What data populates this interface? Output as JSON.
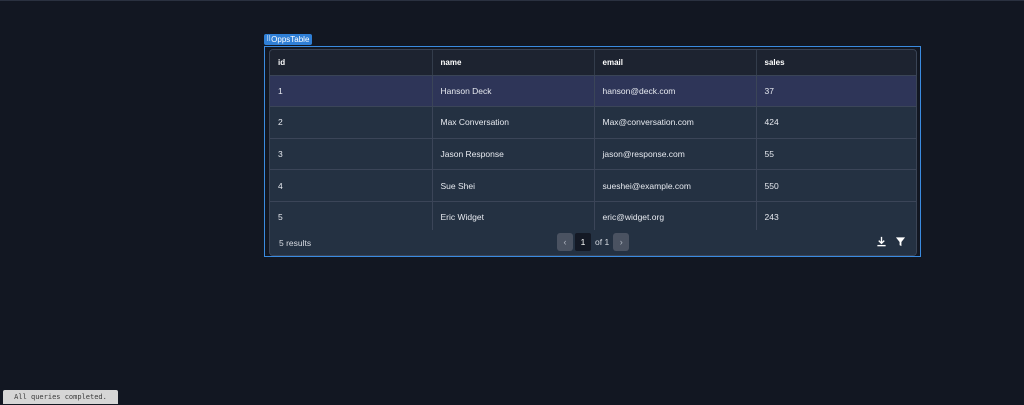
{
  "widget": {
    "tag_label": "OppsTable"
  },
  "table": {
    "columns": [
      "id",
      "name",
      "email",
      "sales"
    ],
    "rows": [
      [
        "1",
        "Hanson Deck",
        "hanson@deck.com",
        "37"
      ],
      [
        "2",
        "Max Conversation",
        "Max@conversation.com",
        "424"
      ],
      [
        "3",
        "Jason Response",
        "jason@response.com",
        "55"
      ],
      [
        "4",
        "Sue Shei",
        "sueshei@example.com",
        "550"
      ],
      [
        "5",
        "Eric Widget",
        "eric@widget.org",
        "243"
      ]
    ],
    "selected_row_id": "1"
  },
  "footer": {
    "results_text": "5 results",
    "prev_icon": "chevron-left-icon",
    "next_icon": "chevron-right-icon",
    "current_page": "1",
    "of_text": "of 1",
    "download_icon": "download-icon",
    "filter_icon": "filter-icon"
  },
  "status": {
    "text": "All queries completed."
  },
  "colors": {
    "background": "#121722",
    "accent": "#2f7fd6",
    "selected_row": "#2e3558",
    "row": "#243142",
    "header": "#1d2330"
  }
}
